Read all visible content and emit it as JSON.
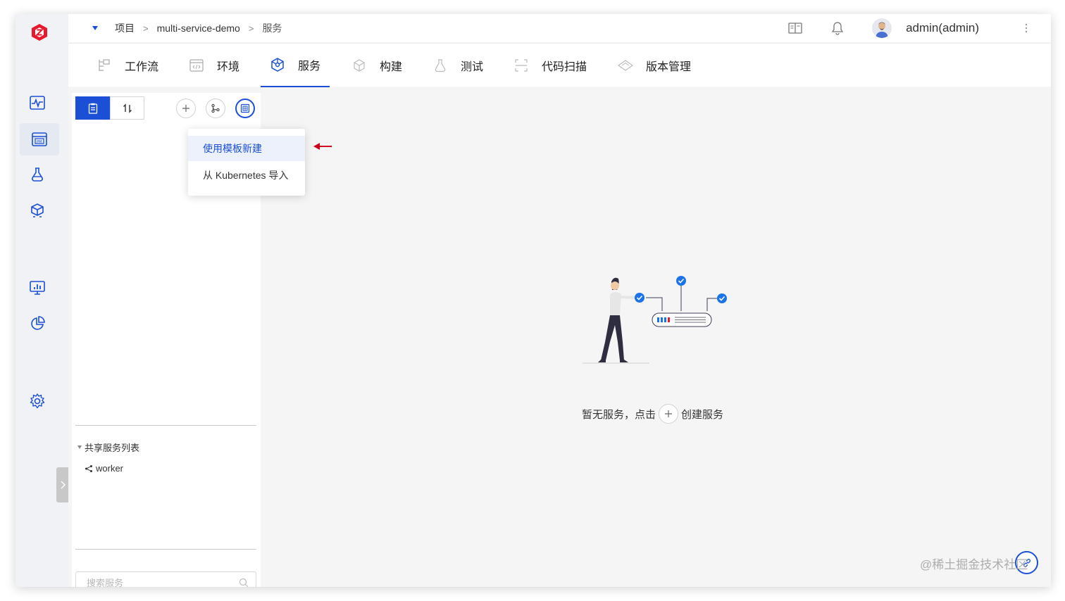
{
  "app": {
    "logo_icon": "zadig-logo-icon",
    "brand_color": "#e8192c",
    "accent_color": "#1a4fd6"
  },
  "breadcrumb": {
    "items": [
      "项目",
      "multi-service-demo",
      "服务"
    ],
    "separator": ">"
  },
  "header": {
    "username": "admin(admin)",
    "icons": [
      "book-icon",
      "bell-icon",
      "avatar",
      "more-icon"
    ]
  },
  "sidebar": {
    "items": [
      {
        "icon": "activity-icon"
      },
      {
        "icon": "project-pm-icon",
        "active": true
      },
      {
        "icon": "flask-icon"
      },
      {
        "icon": "artifact-box-icon"
      },
      {
        "icon": "monitor-chart-icon"
      },
      {
        "icon": "pie-chart-icon"
      },
      {
        "icon": "gear-icon"
      }
    ]
  },
  "tabs": [
    {
      "label": "工作流",
      "icon": "workflow-icon"
    },
    {
      "label": "环境",
      "icon": "environment-icon"
    },
    {
      "label": "服务",
      "icon": "service-icon",
      "active": true
    },
    {
      "label": "构建",
      "icon": "build-icon"
    },
    {
      "label": "测试",
      "icon": "test-icon"
    },
    {
      "label": "代码扫描",
      "icon": "scan-icon"
    },
    {
      "label": "版本管理",
      "icon": "version-icon"
    }
  ],
  "service_panel": {
    "view_toggle": [
      "list-view-icon",
      "sort-icon"
    ],
    "actions": [
      "add-icon",
      "git-branch-icon",
      "template-icon"
    ],
    "shared_list_title": "共享服务列表",
    "shared_services": [
      "worker"
    ],
    "search_placeholder": "搜索服务"
  },
  "dropdown": {
    "items": [
      "使用模板新建",
      "从 Kubernetes 导入"
    ],
    "highlighted_index": 0
  },
  "empty_state": {
    "text_before": "暂无服务，点击",
    "text_after": "创建服务"
  },
  "watermark": "@稀土掘金技术社区"
}
